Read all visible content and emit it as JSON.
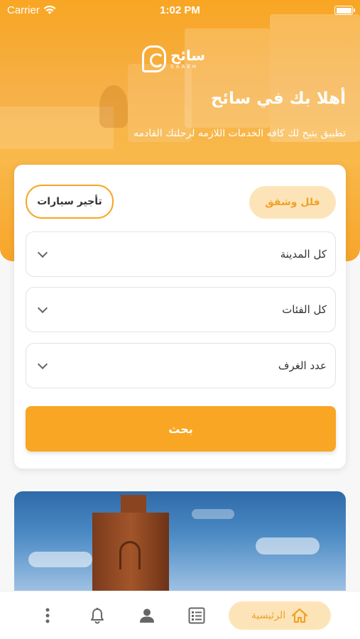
{
  "status_bar": {
    "carrier": "Carrier",
    "time": "1:02 PM"
  },
  "logo": {
    "name": "سائح",
    "sub": "SAAEH"
  },
  "hero": {
    "title": "أهلا بك في سائح",
    "subtitle": "تطبيق يتيح لك كافه الخدمات اللازمه لرحلتك القادمه"
  },
  "tabs": {
    "villas": "فلل وشقق",
    "cars": "تأجير سيارات"
  },
  "filters": {
    "city": "كل المدينة",
    "category": "كل الفئات",
    "rooms": "عدد الغرف"
  },
  "search_label": "بحث",
  "nav": {
    "home_label": "الرئيسية"
  },
  "colors": {
    "accent": "#f8a623",
    "accent_light": "#fde4b8"
  }
}
